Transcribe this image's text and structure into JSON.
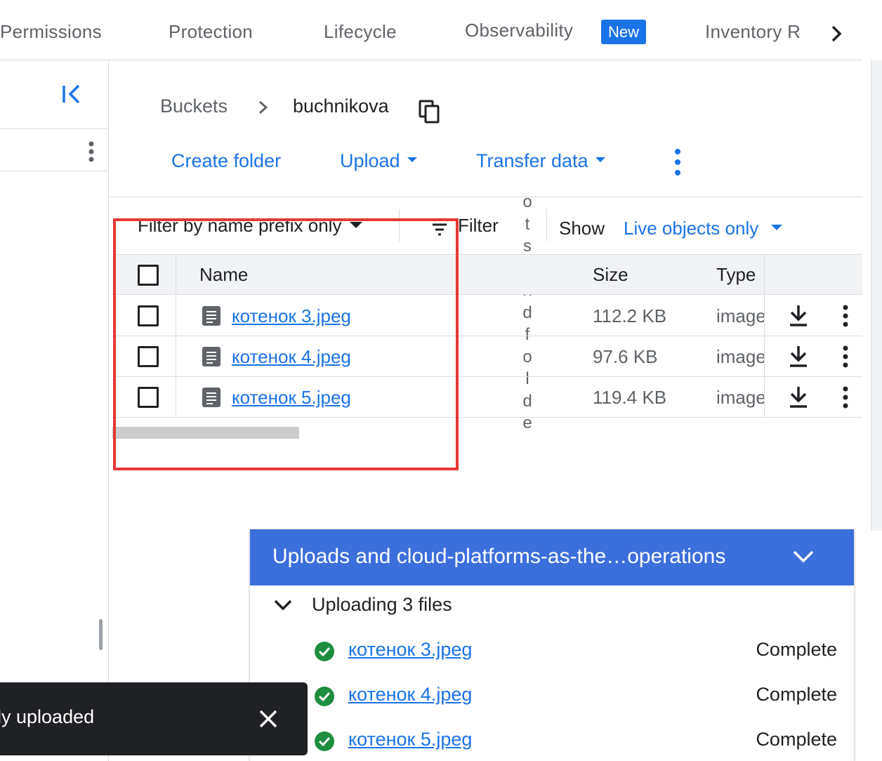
{
  "tabs": [
    {
      "label": "Permissions"
    },
    {
      "label": "Protection"
    },
    {
      "label": "Lifecycle"
    },
    {
      "label": "Observability",
      "badge": "New"
    },
    {
      "label": "Inventory R"
    }
  ],
  "breadcrumb": {
    "root": "Buckets",
    "current": "buchnikova"
  },
  "actions": {
    "create_folder": "Create folder",
    "upload": "Upload",
    "transfer_data": "Transfer data"
  },
  "filter": {
    "prefix_select": "Filter by name prefix only",
    "filter_label": "Filter",
    "vertical_overlay": "ots and folder",
    "show_label": "Show",
    "show_select": "Live objects only"
  },
  "table": {
    "headers": {
      "name": "Name",
      "size": "Size",
      "type": "Type"
    },
    "rows": [
      {
        "name": "котенок 3.jpeg",
        "size": "112.2 KB",
        "type": "image"
      },
      {
        "name": "котенок 4.jpeg",
        "size": "97.6 KB",
        "type": "image"
      },
      {
        "name": "котенок 5.jpeg",
        "size": "119.4 KB",
        "type": "image"
      }
    ]
  },
  "upload_panel": {
    "title": "Uploads and cloud-platforms-as-the…operations",
    "subtitle": "Uploading 3 files",
    "items": [
      {
        "name": "котенок 3.jpeg",
        "status": "Complete"
      },
      {
        "name": "котенок 4.jpeg",
        "status": "Complete"
      },
      {
        "name": "котенок 5.jpeg",
        "status": "Complete"
      }
    ]
  },
  "toast": {
    "message": "ly uploaded"
  },
  "colors": {
    "accent": "#1a73e8",
    "upload_header": "#3b6fdc",
    "highlight_box": "#e53935",
    "success": "#1e8e3e",
    "toast_bg": "#202124"
  }
}
